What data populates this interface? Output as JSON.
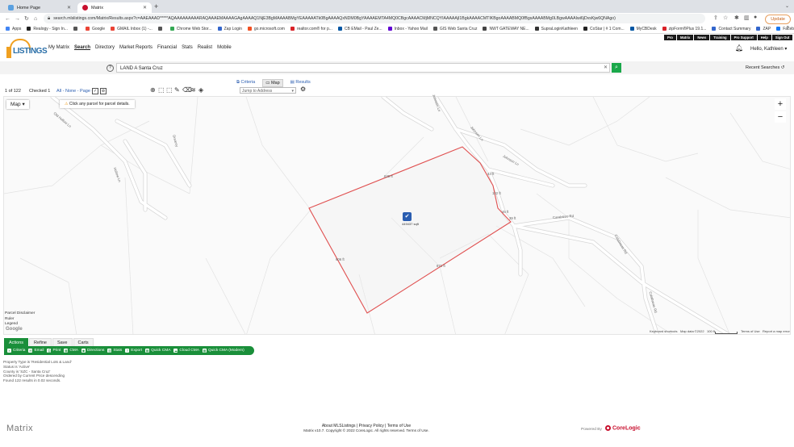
{
  "browser": {
    "tabs": [
      {
        "title": "Home Page",
        "favicon_color": "#5aa0e0"
      },
      {
        "title": "Matrix",
        "favicon_color": "#c8102e"
      }
    ],
    "new_tab_label": "+",
    "url": "search.mlslistings.com/Matrix/Results.aspx?c=AAEAAAD*****AQAAAAAAAAARAQAAAEMAAAAGAgAAAAQ1NjE3BgMAAAABMgYEAAAAATk0BgAAAAQxNDM0BgYAAAAEMTA4MQ0CBgcAAAACMjMNCQYIAAAAAjI1BgkAAAACMTIKBgoAAAABMQ0fBgsAAAABMg0LBgwAAAAIwi6jDvsKjw6QNAgo)",
    "update_label": "Update",
    "bookmarks": [
      {
        "label": "Apps",
        "color": "#4285f4"
      },
      {
        "label": "Realogy - Sign In...",
        "color": "#222"
      },
      {
        "label": "",
        "color": "#555"
      },
      {
        "label": "Google",
        "color": "#ea4335"
      },
      {
        "label": "GMAIL Inbox (1) -...",
        "color": "#ea4335"
      },
      {
        "label": "",
        "color": "#555"
      },
      {
        "label": "Chrome Web Stor...",
        "color": "#34a853"
      },
      {
        "label": "Zap Login",
        "color": "#3366cc"
      },
      {
        "label": "go.microsoft.com",
        "color": "#f25022"
      },
      {
        "label": "realtor.com® for p...",
        "color": "#d92228"
      },
      {
        "label": "CB EMail - Paul Ze...",
        "color": "#0056a3"
      },
      {
        "label": "Inbox - Yahoo Mail",
        "color": "#6001d2"
      },
      {
        "label": "GIS Web Santa Cruz",
        "color": "#555"
      },
      {
        "label": "NWT GATEWAY NE...",
        "color": "#444"
      },
      {
        "label": "SupraLoginKathleen",
        "color": "#333"
      },
      {
        "label": "CoStar | # 1 Com...",
        "color": "#222"
      },
      {
        "label": "MyCBDesk",
        "color": "#0056a3"
      },
      {
        "label": "zipForm®Plus 19.1...",
        "color": "#d92228"
      },
      {
        "label": "Contact Summary",
        "color": "#3366cc"
      },
      {
        "label": "ZAP",
        "color": "#3366cc"
      },
      {
        "label": "Facebook",
        "color": "#1877f2"
      }
    ]
  },
  "top_links": [
    "Pro",
    "Matrix",
    "News",
    "Training",
    "Pro Support",
    "Help",
    "Sign Out"
  ],
  "logo_text": "LISTINGS",
  "main_nav": [
    {
      "label": "My Matrix",
      "selected": false
    },
    {
      "label": "Search",
      "selected": true
    },
    {
      "label": "Directory",
      "selected": false
    },
    {
      "label": "Market Reports",
      "selected": false
    },
    {
      "label": "Financial",
      "selected": false
    },
    {
      "label": "Stats",
      "selected": false
    },
    {
      "label": "Realist",
      "selected": false
    },
    {
      "label": "Mobile",
      "selected": false
    }
  ],
  "user_greeting": "Hello, Kathleen",
  "search": {
    "value": "LAND A Santa Cruz",
    "recent_label": "Recent Searches"
  },
  "view_tabs": [
    "Criteria",
    "Map",
    "Results"
  ],
  "results": {
    "count": "1 of 122",
    "checked": "Checked 1",
    "select_links": "All - None - Page -",
    "jump_placeholder": "Jump to Address"
  },
  "map": {
    "type_label": "Map",
    "hint": "Click any parcel for parcel details.",
    "roads": [
      "Old Hollow Ln",
      "Dreamy",
      "Hollow Ln",
      "Johnson Ln",
      "Johnson Ln",
      "Johnson Ln",
      "Carabizzo Rd",
      "Calabasas Rd",
      "Calabasas Rd"
    ],
    "dims": [
      "639 ft",
      "43 ft",
      "122 ft",
      "46 ft",
      "39 ft",
      "871 ft",
      "606 ft"
    ],
    "parcel_area": "449437 sqft",
    "legend_links": [
      "Parcel Disclaimer",
      "Ruler",
      "Legend"
    ],
    "google_label": "Google",
    "attribution": [
      "Keyboard shortcuts",
      "Map data ©2022",
      "100 ft",
      "Terms of Use",
      "Report a map error"
    ],
    "parcel_color": "#e05050"
  },
  "action_tabs": [
    "Actions",
    "Refine",
    "Save",
    "Carts"
  ],
  "actions": [
    "Criteria",
    "Email",
    "Print",
    "CMA",
    "Directions",
    "Stats",
    "Export",
    "Quick CMA",
    "Cloud CMA",
    "Quick CMA (Modern)"
  ],
  "criteria_summary": [
    "Property Type is 'Residential Lots & Land'",
    "Status is 'Active'",
    "County is 'SZC - Santa Cruz'",
    "Ordered by Current Price descending",
    "Found 122 results in 0.02 seconds."
  ],
  "footer": {
    "brand": "Matrix",
    "links": "About MLSListings | Privacy Policy | Terms of Use",
    "copyright": "Matrix v10.7. Copyright © 2022 CoreLogic. All rights reserved. Terms of Use.",
    "powered_by": "Powered By",
    "company": "CoreLogic"
  },
  "colors": {
    "accent": "#1a8f3a",
    "link": "#2a5db0",
    "brand_orange": "#f0a020"
  }
}
